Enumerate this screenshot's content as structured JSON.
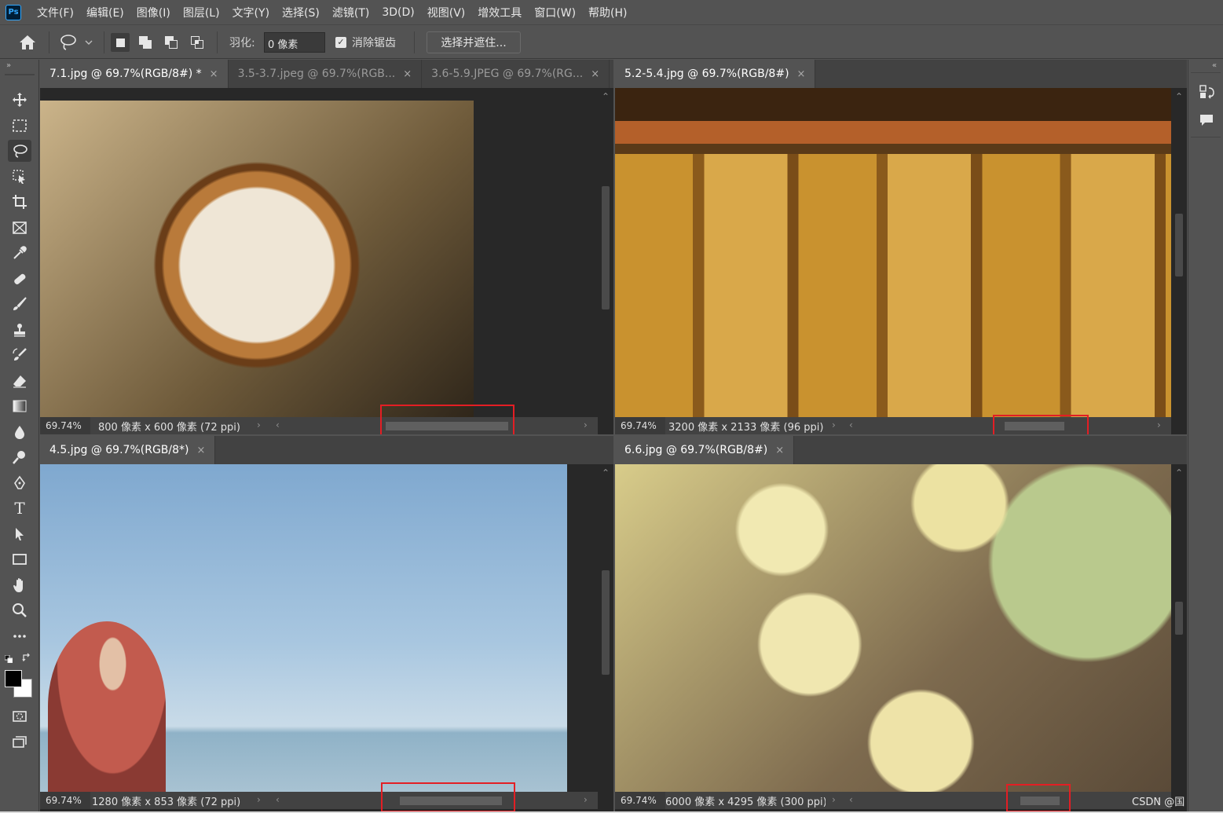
{
  "menubar": {
    "logo": "Ps",
    "items": [
      "文件(F)",
      "编辑(E)",
      "图像(I)",
      "图层(L)",
      "文字(Y)",
      "选择(S)",
      "滤镜(T)",
      "3D(D)",
      "视图(V)",
      "增效工具",
      "窗口(W)",
      "帮助(H)"
    ]
  },
  "options": {
    "feather_label": "羽化:",
    "feather_value": "0 像素",
    "antialias_label": "消除锯齿",
    "antialias_checked": true,
    "select_mask_label": "选择并遮住..."
  },
  "tools": [
    "move-icon",
    "marquee-icon",
    "lasso-icon",
    "object-select-icon",
    "crop-icon",
    "frame-icon",
    "eyedropper-icon",
    "healing-icon",
    "brush-icon",
    "stamp-icon",
    "history-brush-icon",
    "eraser-icon",
    "gradient-icon",
    "blur-icon",
    "dodge-icon",
    "pen-icon",
    "type-icon",
    "path-select-icon",
    "rectangle-icon",
    "hand-icon",
    "zoom-icon",
    "more-icon"
  ],
  "colors": {
    "foreground": "#000000",
    "background": "#ffffff",
    "highlight": "#e31e24"
  },
  "windows": {
    "top_left": {
      "tabs": [
        {
          "label": "7.1.jpg @ 69.7%(RGB/8#) *",
          "active": true
        },
        {
          "label": "3.5-3.7.jpeg @ 69.7%(RGB...",
          "active": false
        },
        {
          "label": "3.6-5.9.JPEG @ 69.7%(RG...",
          "active": false
        }
      ],
      "zoom": "69.74%",
      "dims": "800 像素 x 600 像素 (72 ppi)"
    },
    "top_right": {
      "tabs": [
        {
          "label": "5.2-5.4.jpg @ 69.7%(RGB/8#)",
          "active": true
        }
      ],
      "zoom": "69.74%",
      "dims": "3200 像素 x 2133 像素 (96 ppi)"
    },
    "bottom_left": {
      "tabs": [
        {
          "label": "4.5.jpg @ 69.7%(RGB/8*)",
          "active": true
        }
      ],
      "zoom": "69.74%",
      "dims": "1280 像素 x 853 像素 (72 ppi)"
    },
    "bottom_right": {
      "tabs": [
        {
          "label": "6.6.jpg @ 69.7%(RGB/8#)",
          "active": true
        }
      ],
      "zoom": "69.74%",
      "dims": "6000 像素 x 4295 像素 (300 ppi)"
    }
  },
  "watermark": "CSDN @国林哥"
}
